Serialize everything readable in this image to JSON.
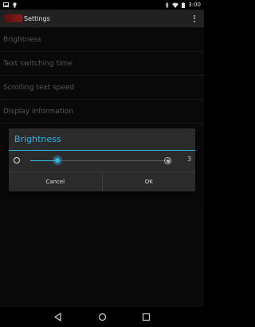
{
  "status_bar": {
    "time": "3:00"
  },
  "app_bar": {
    "title": "Settings"
  },
  "preferences": [
    {
      "label": "Brightness"
    },
    {
      "label": "Text switching time"
    },
    {
      "label": "Scrolling text speed"
    },
    {
      "label": "Display information"
    }
  ],
  "dialog": {
    "title": "Brightness",
    "slider_value": 3,
    "slider_fraction": 0.2,
    "value_label": "3",
    "cancel_label": "Cancel",
    "ok_label": "OK"
  },
  "colors": {
    "accent": "#33b5e5",
    "background": "#121212",
    "dialog": "#2b2b2b"
  },
  "icons": {
    "status_left": [
      "picture-icon",
      "lightbulb-icon"
    ],
    "status_right": [
      "bluetooth-icon",
      "wifi-icon",
      "battery-icon"
    ],
    "nav": [
      "back-icon",
      "home-icon",
      "recents-icon"
    ]
  }
}
